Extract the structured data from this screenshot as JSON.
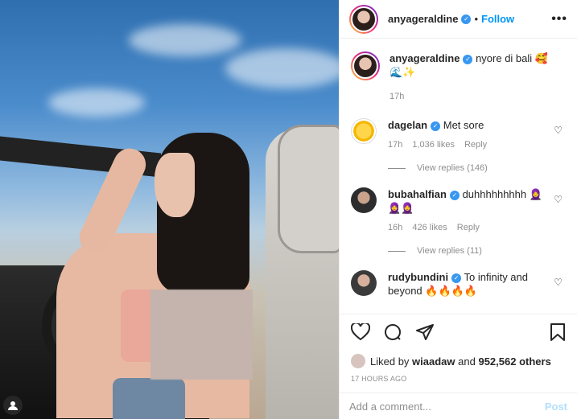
{
  "post": {
    "username": "anyageraldine",
    "follow_label": "Follow",
    "dot": "•",
    "more_label": "•••",
    "caption_text": "nyore di bali 🥰 🌊✨",
    "caption_time": "17h"
  },
  "comments": [
    {
      "username": "dagelan",
      "text": "Met sore",
      "time": "17h",
      "likes": "1,036 likes",
      "reply_label": "Reply",
      "view_replies": "View replies (146)"
    },
    {
      "username": "bubahalfian",
      "text": "duhhhhhhhhh 🧕 🧕🧕",
      "time": "16h",
      "likes": "426 likes",
      "reply_label": "Reply",
      "view_replies": "View replies (11)"
    },
    {
      "username": "rudybundini",
      "text": "To infinity and beyond 🔥🔥🔥🔥"
    }
  ],
  "footer": {
    "liked_by_prefix": "Liked by",
    "liked_by_user": "wiaadaw",
    "liked_by_mid": "and",
    "liked_by_count": "952,562 others",
    "timestamp": "17 HOURS AGO",
    "comment_placeholder": "Add a comment...",
    "post_label": "Post"
  },
  "icons": {
    "heart": "heart-icon",
    "comment": "comment-icon",
    "share": "share-icon",
    "bookmark": "bookmark-icon",
    "account": "account-icon"
  },
  "colors": {
    "accent": "#0095f6",
    "verified": "#3897f0",
    "muted": "#8e8e8e"
  }
}
